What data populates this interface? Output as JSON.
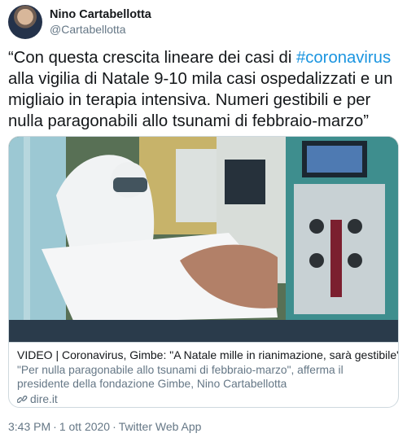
{
  "author": {
    "name": "Nino Cartabellotta",
    "handle": "@Cartabellotta"
  },
  "tweet": {
    "text_before": "“Con questa crescita lineare dei casi di ",
    "hashtag": "#coronavirus",
    "text_after": " alla vigilia di Natale 9-10 mila casi ospedalizzati e un migliaio in terapia intensiva. Numeri gestibili e per nulla paragonabili allo tsunami di febbraio-marzo”"
  },
  "card": {
    "image_icon": "hospital-icu-photo",
    "title": "VIDEO | Coronavirus, Gimbe: \"A Natale mille in rianimazione, sarà gestibile\"",
    "description": "\"Per nulla paragonabile allo tsunami di febbraio-marzo\", afferma il presidente della fondazione Gimbe, Nino Cartabellotta",
    "domain_icon": "link-icon",
    "domain": "dire.it"
  },
  "meta": {
    "time": "3:43 PM",
    "separator": "·",
    "date": "1 ott 2020",
    "source": "Twitter Web App"
  },
  "colors": {
    "link": "#1b95e0",
    "secondary_text": "#657786",
    "border": "#cfd9de"
  }
}
